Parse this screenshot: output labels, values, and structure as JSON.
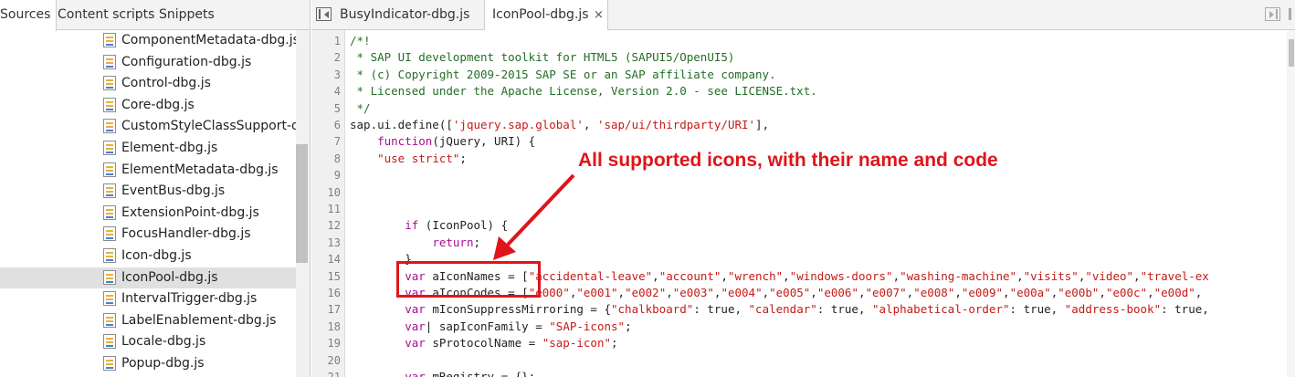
{
  "left_panel": {
    "tabs": [
      "Sources",
      "Content scripts",
      "Snippets"
    ],
    "files": [
      "ComponentMetadata-dbg.js",
      "Configuration-dbg.js",
      "Control-dbg.js",
      "Core-dbg.js",
      "CustomStyleClassSupport-dbg.js",
      "Element-dbg.js",
      "ElementMetadata-dbg.js",
      "EventBus-dbg.js",
      "ExtensionPoint-dbg.js",
      "FocusHandler-dbg.js",
      "Icon-dbg.js",
      "IconPool-dbg.js",
      "IntervalTrigger-dbg.js",
      "LabelEnablement-dbg.js",
      "Locale-dbg.js",
      "Popup-dbg.js"
    ],
    "selected_file": "IconPool-dbg.js"
  },
  "editor": {
    "tabs": [
      {
        "label": "BusyIndicator-dbg.js",
        "active": false
      },
      {
        "label": "IconPool-dbg.js",
        "active": true
      }
    ],
    "close_glyph": "×",
    "lines": [
      {
        "n": "1",
        "segments": [
          {
            "t": "/*!",
            "c": "comment"
          }
        ]
      },
      {
        "n": "2",
        "segments": [
          {
            "t": " * SAP UI development toolkit for HTML5 (SAPUI5/OpenUI5)",
            "c": "comment"
          }
        ]
      },
      {
        "n": "3",
        "segments": [
          {
            "t": " * (c) Copyright 2009-2015 SAP SE or an SAP affiliate company.",
            "c": "comment"
          }
        ]
      },
      {
        "n": "4",
        "segments": [
          {
            "t": " * Licensed under the Apache License, Version 2.0 - see LICENSE.txt.",
            "c": "comment"
          }
        ]
      },
      {
        "n": "5",
        "segments": [
          {
            "t": " */",
            "c": "comment"
          }
        ]
      },
      {
        "n": "6",
        "segments": [
          {
            "t": "sap.ui.define([",
            "c": "plain"
          },
          {
            "t": "'jquery.sap.global'",
            "c": "str"
          },
          {
            "t": ", ",
            "c": "plain"
          },
          {
            "t": "'sap/ui/thirdparty/URI'",
            "c": "str"
          },
          {
            "t": "],",
            "c": "plain"
          }
        ]
      },
      {
        "n": "7",
        "segments": [
          {
            "t": "    ",
            "c": "plain"
          },
          {
            "t": "function",
            "c": "kw"
          },
          {
            "t": "(jQuery, URI) {",
            "c": "plain"
          }
        ]
      },
      {
        "n": "8",
        "segments": [
          {
            "t": "    ",
            "c": "plain"
          },
          {
            "t": "\"use strict\"",
            "c": "str"
          },
          {
            "t": ";",
            "c": "plain"
          }
        ]
      },
      {
        "n": "9",
        "segments": []
      },
      {
        "n": "10",
        "segments": []
      },
      {
        "n": "11",
        "segments": []
      },
      {
        "n": "12",
        "segments": [
          {
            "t": "        ",
            "c": "plain"
          },
          {
            "t": "if",
            "c": "kw"
          },
          {
            "t": " (IconPool) {",
            "c": "plain"
          }
        ]
      },
      {
        "n": "13",
        "segments": [
          {
            "t": "            ",
            "c": "plain"
          },
          {
            "t": "return",
            "c": "kw"
          },
          {
            "t": ";",
            "c": "plain"
          }
        ]
      },
      {
        "n": "14",
        "segments": [
          {
            "t": "        }",
            "c": "plain"
          }
        ]
      },
      {
        "n": "15",
        "segments": [
          {
            "t": "        ",
            "c": "plain"
          },
          {
            "t": "var",
            "c": "kw"
          },
          {
            "t": " aIconNames = [",
            "c": "plain"
          },
          {
            "t": "\"accidental-leave\"",
            "c": "str"
          },
          {
            "t": ",",
            "c": "plain"
          },
          {
            "t": "\"account\"",
            "c": "str"
          },
          {
            "t": ",",
            "c": "plain"
          },
          {
            "t": "\"wrench\"",
            "c": "str"
          },
          {
            "t": ",",
            "c": "plain"
          },
          {
            "t": "\"windows-doors\"",
            "c": "str"
          },
          {
            "t": ",",
            "c": "plain"
          },
          {
            "t": "\"washing-machine\"",
            "c": "str"
          },
          {
            "t": ",",
            "c": "plain"
          },
          {
            "t": "\"visits\"",
            "c": "str"
          },
          {
            "t": ",",
            "c": "plain"
          },
          {
            "t": "\"video\"",
            "c": "str"
          },
          {
            "t": ",",
            "c": "plain"
          },
          {
            "t": "\"travel-ex",
            "c": "str"
          }
        ]
      },
      {
        "n": "16",
        "segments": [
          {
            "t": "        ",
            "c": "plain"
          },
          {
            "t": "var",
            "c": "kw"
          },
          {
            "t": " aIconCodes = [",
            "c": "plain"
          },
          {
            "t": "\"e000\"",
            "c": "str"
          },
          {
            "t": ",",
            "c": "plain"
          },
          {
            "t": "\"e001\"",
            "c": "str"
          },
          {
            "t": ",",
            "c": "plain"
          },
          {
            "t": "\"e002\"",
            "c": "str"
          },
          {
            "t": ",",
            "c": "plain"
          },
          {
            "t": "\"e003\"",
            "c": "str"
          },
          {
            "t": ",",
            "c": "plain"
          },
          {
            "t": "\"e004\"",
            "c": "str"
          },
          {
            "t": ",",
            "c": "plain"
          },
          {
            "t": "\"e005\"",
            "c": "str"
          },
          {
            "t": ",",
            "c": "plain"
          },
          {
            "t": "\"e006\"",
            "c": "str"
          },
          {
            "t": ",",
            "c": "plain"
          },
          {
            "t": "\"e007\"",
            "c": "str"
          },
          {
            "t": ",",
            "c": "plain"
          },
          {
            "t": "\"e008\"",
            "c": "str"
          },
          {
            "t": ",",
            "c": "plain"
          },
          {
            "t": "\"e009\"",
            "c": "str"
          },
          {
            "t": ",",
            "c": "plain"
          },
          {
            "t": "\"e00a\"",
            "c": "str"
          },
          {
            "t": ",",
            "c": "plain"
          },
          {
            "t": "\"e00b\"",
            "c": "str"
          },
          {
            "t": ",",
            "c": "plain"
          },
          {
            "t": "\"e00c\"",
            "c": "str"
          },
          {
            "t": ",",
            "c": "plain"
          },
          {
            "t": "\"e00d\"",
            "c": "str"
          },
          {
            "t": ",",
            "c": "plain"
          }
        ]
      },
      {
        "n": "17",
        "segments": [
          {
            "t": "        ",
            "c": "plain"
          },
          {
            "t": "var",
            "c": "kw"
          },
          {
            "t": " mIconSuppressMirroring = {",
            "c": "plain"
          },
          {
            "t": "\"chalkboard\"",
            "c": "str"
          },
          {
            "t": ": true, ",
            "c": "plain"
          },
          {
            "t": "\"calendar\"",
            "c": "str"
          },
          {
            "t": ": true, ",
            "c": "plain"
          },
          {
            "t": "\"alphabetical-order\"",
            "c": "str"
          },
          {
            "t": ": true, ",
            "c": "plain"
          },
          {
            "t": "\"address-book\"",
            "c": "str"
          },
          {
            "t": ": true,",
            "c": "plain"
          }
        ]
      },
      {
        "n": "18",
        "segments": [
          {
            "t": "        ",
            "c": "plain"
          },
          {
            "t": "var",
            "c": "kw"
          },
          {
            "t": "| sapIconFamily = ",
            "c": "plain"
          },
          {
            "t": "\"SAP-icons\"",
            "c": "str"
          },
          {
            "t": ";",
            "c": "plain"
          }
        ]
      },
      {
        "n": "19",
        "segments": [
          {
            "t": "        ",
            "c": "plain"
          },
          {
            "t": "var",
            "c": "kw"
          },
          {
            "t": " sProtocolName = ",
            "c": "plain"
          },
          {
            "t": "\"sap-icon\"",
            "c": "str"
          },
          {
            "t": ";",
            "c": "plain"
          }
        ]
      },
      {
        "n": "20",
        "segments": []
      },
      {
        "n": "21",
        "segments": [
          {
            "t": "        ",
            "c": "plain"
          },
          {
            "t": "var",
            "c": "kw"
          },
          {
            "t": " mRegistry = {};",
            "c": "plain"
          }
        ]
      }
    ]
  },
  "annotation": {
    "text": "All supported icons, with their name and code",
    "color": "#e0141a"
  },
  "colors": {
    "comment": "#236e25",
    "keyword": "#aa0d91",
    "string": "#c41a16",
    "selected_row": "#e0e0e0"
  }
}
